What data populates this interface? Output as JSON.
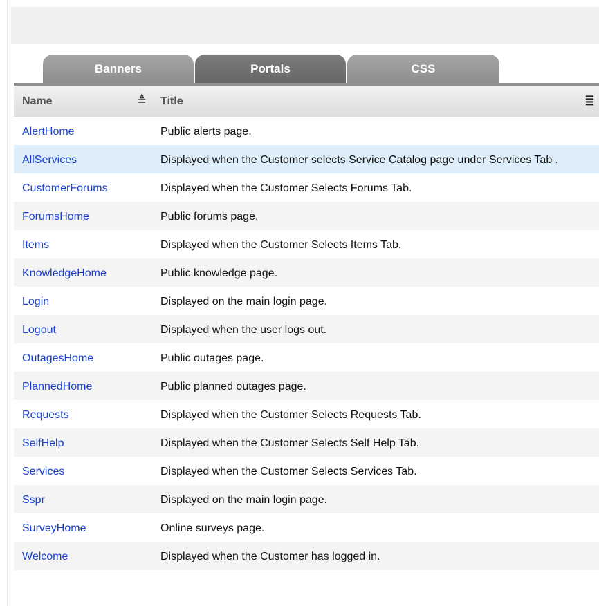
{
  "tabs": [
    {
      "label": "Banners"
    },
    {
      "label": "Portals"
    },
    {
      "label": "CSS"
    }
  ],
  "table": {
    "columns": {
      "name": "Name",
      "title": "Title"
    },
    "rows": [
      {
        "name": "AlertHome",
        "title": "Public alerts page."
      },
      {
        "name": "AllServices",
        "title": "Displayed when the Customer selects Service Catalog page under Services Tab ."
      },
      {
        "name": "CustomerForums",
        "title": "Displayed when the Customer Selects Forums Tab."
      },
      {
        "name": "ForumsHome",
        "title": "Public forums page."
      },
      {
        "name": "Items",
        "title": "Displayed when the Customer Selects Items Tab."
      },
      {
        "name": "KnowledgeHome",
        "title": "Public knowledge page."
      },
      {
        "name": "Login",
        "title": "Displayed on the main login page."
      },
      {
        "name": "Logout",
        "title": "Displayed when the user logs out."
      },
      {
        "name": "OutagesHome",
        "title": "Public outages page."
      },
      {
        "name": "PlannedHome",
        "title": "Public planned outages page."
      },
      {
        "name": "Requests",
        "title": "Displayed when the Customer Selects Requests Tab."
      },
      {
        "name": "SelfHelp",
        "title": "Displayed when the Customer Selects Self Help Tab."
      },
      {
        "name": "Services",
        "title": "Displayed when the Customer Selects Services Tab."
      },
      {
        "name": "Sspr",
        "title": "Displayed on the main login page."
      },
      {
        "name": "SurveyHome",
        "title": "Online surveys page."
      },
      {
        "name": "Welcome",
        "title": "Displayed when the Customer has logged in."
      }
    ],
    "selected_row": "AllServices"
  },
  "icons": {
    "sort": "sort-ascending-icon",
    "columns": "columns-menu-icon"
  },
  "colors": {
    "link": "#1a40cc",
    "selected_row": "#ddeefa",
    "active_tab": "#6e6e6e",
    "inactive_tab": "#9a9a9a"
  }
}
